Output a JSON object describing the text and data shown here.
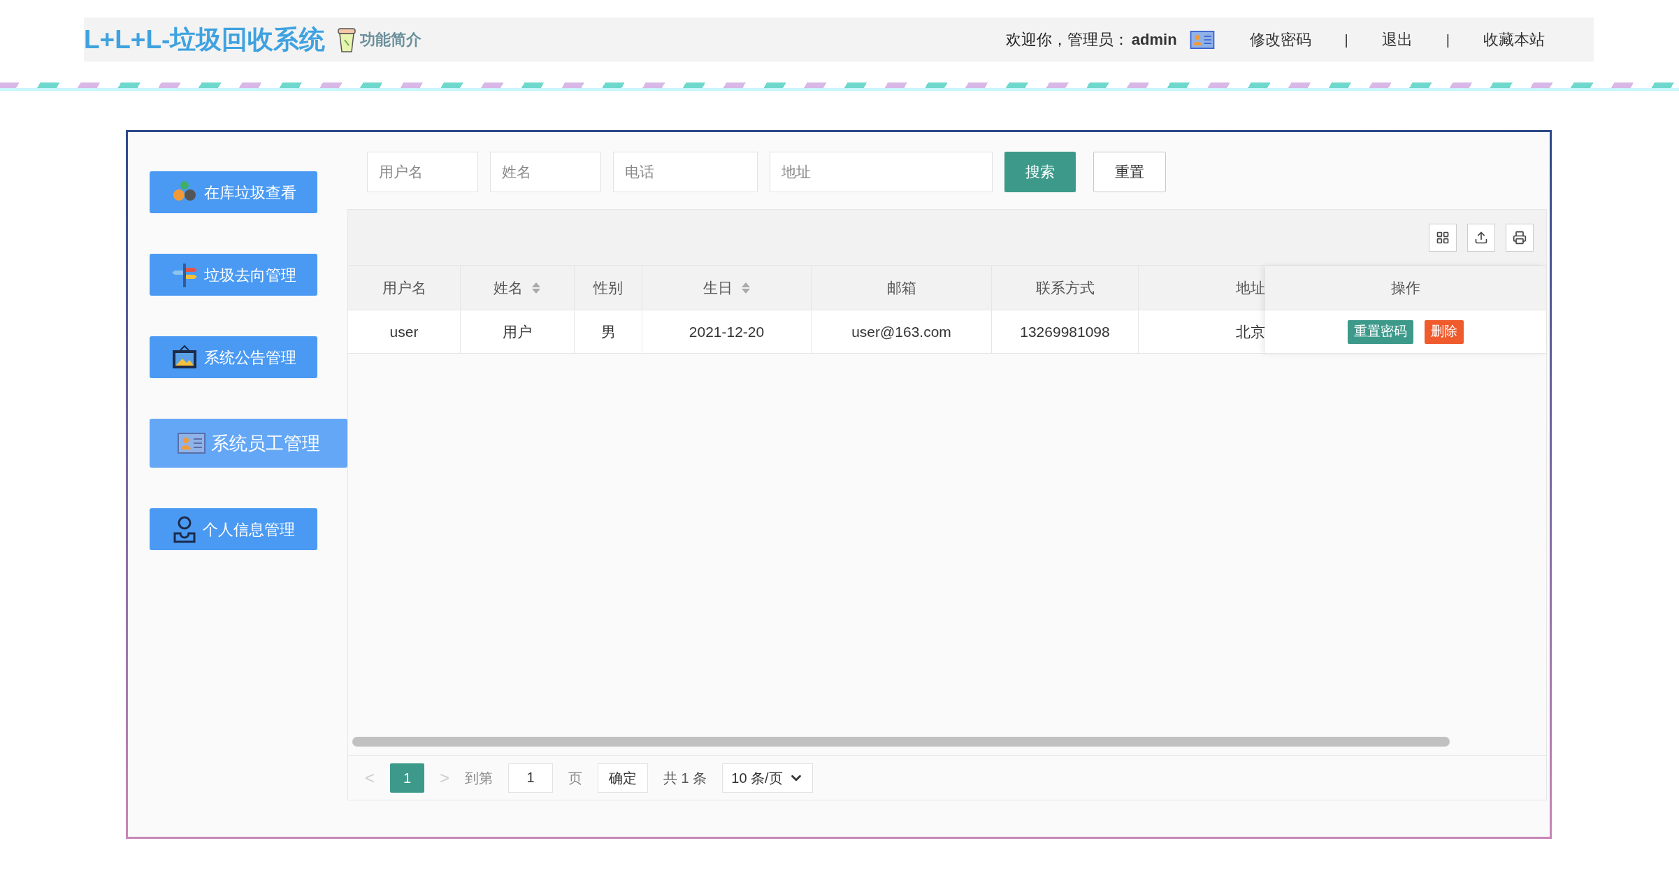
{
  "header": {
    "title": "L+L+L-垃圾回收系统",
    "intro_link": "功能简介",
    "welcome": "欢迎你，管理员：",
    "user": "admin",
    "nav": [
      {
        "kind": "link",
        "text": "修改密码"
      },
      {
        "kind": "separator",
        "text": "|"
      },
      {
        "kind": "link",
        "text": "退出"
      },
      {
        "kind": "separator",
        "text": "|"
      },
      {
        "kind": "link",
        "text": "收藏本站"
      }
    ]
  },
  "sidebar": {
    "items": [
      {
        "label": "在库垃圾查看",
        "selected": false
      },
      {
        "label": "垃圾去向管理",
        "selected": false
      },
      {
        "label": "系统公告管理",
        "selected": false
      },
      {
        "label": "系统员工管理",
        "selected": true
      },
      {
        "label": "个人信息管理",
        "selected": false
      }
    ]
  },
  "search": {
    "fields": [
      {
        "placeholder": "用户名"
      },
      {
        "placeholder": "姓名"
      },
      {
        "placeholder": "电话"
      },
      {
        "placeholder": "地址"
      }
    ],
    "search_button": "搜索",
    "reset_button": "重置"
  },
  "table": {
    "columns": [
      {
        "label": "用户名",
        "sortable": false
      },
      {
        "label": "姓名",
        "sortable": true
      },
      {
        "label": "性别",
        "sortable": false
      },
      {
        "label": "生日",
        "sortable": true
      },
      {
        "label": "邮箱",
        "sortable": false
      },
      {
        "label": "联系方式",
        "sortable": false
      },
      {
        "label": "地址",
        "sortable": false
      },
      {
        "label": "操作",
        "sortable": false
      }
    ],
    "rows": [
      {
        "cells": [
          "user",
          "用户",
          "男",
          "2021-12-20",
          "user@163.com",
          "13269981098",
          "北京"
        ],
        "actions": [
          {
            "kind": "primary",
            "label": "重置密码"
          },
          {
            "kind": "danger",
            "label": "删除"
          }
        ]
      }
    ]
  },
  "pagination": {
    "prev": "<",
    "pages": [
      {
        "label": "1",
        "selected": true
      }
    ],
    "next": ">",
    "goto": "到第",
    "page_value": "1",
    "page_unit": "页",
    "confirm": "确定",
    "total": "共 1 条",
    "page_size": "10 条/页"
  }
}
